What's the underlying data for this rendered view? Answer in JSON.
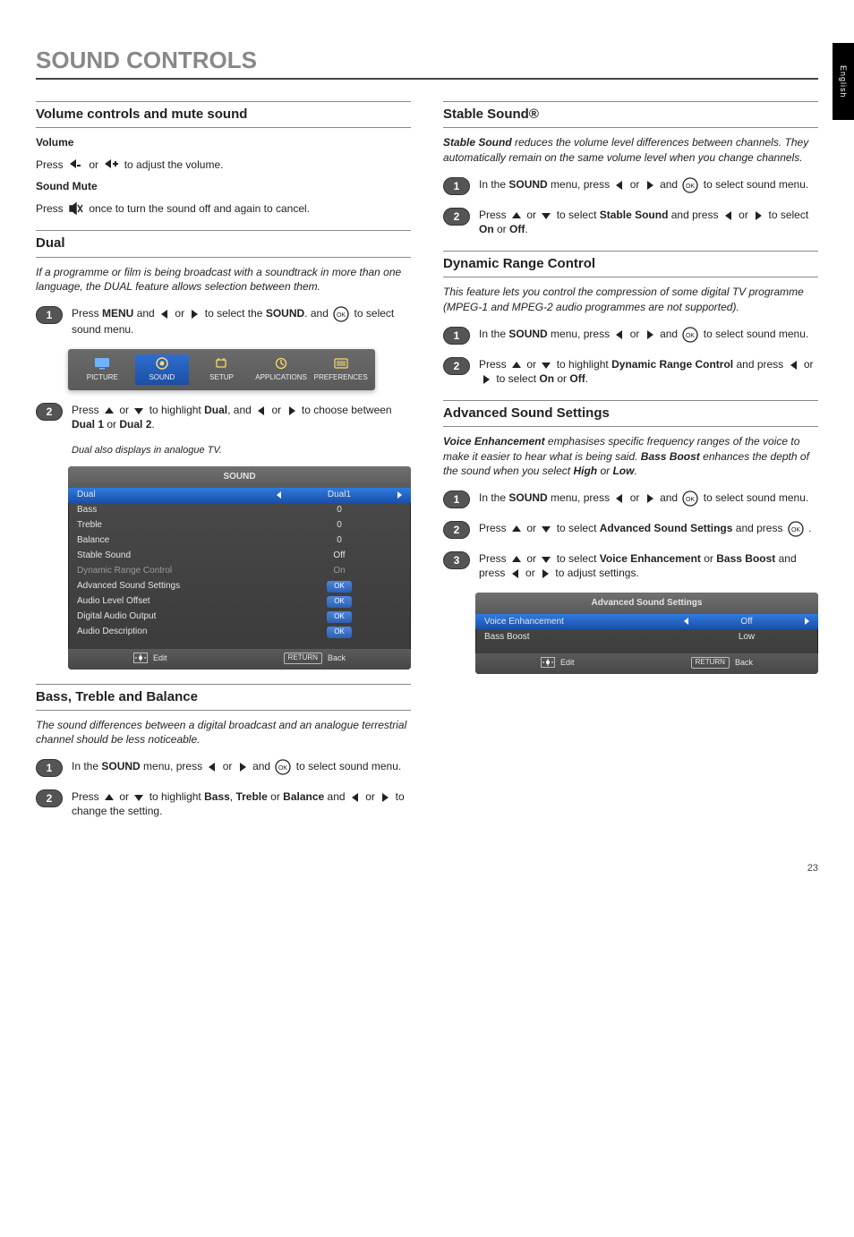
{
  "side_tab": "English",
  "page_title": "SOUND CONTROLS",
  "page_number": "23",
  "vol_mute": {
    "heading": "Volume controls and mute sound",
    "subhead_volume": "Volume",
    "volume_text_prefix": "Press ",
    "volume_text_mid": " or ",
    "volume_text_suffix": " to adjust the volume.",
    "subhead_mute": "Sound Mute",
    "mute_text_prefix": "Press ",
    "mute_text_suffix": " once to turn the sound off and again to cancel."
  },
  "dual": {
    "heading": "Dual",
    "intro": "If a programme or film is being broadcast with a soundtrack in more than one language, the DUAL feature allows selection between them.",
    "step1_prefix": "Press ",
    "step1_mid_a": " and ",
    "step1_mid_b": " or ",
    "step1_suffix": " to select the ",
    "step1_target": "SOUND",
    "step1_end": ".",
    "step2_part1": "Press ",
    "step2_part2": " or ",
    "step2_part3": " to highlight ",
    "step2_target": "Dual",
    "step2_part4": ", and ",
    "step2_part5": " or ",
    "step2_part6": " to choose between ",
    "step2_opt1": "Dual 1",
    "step2_opt2": "Dual 2",
    "step2_end": "."
  },
  "ribbon": {
    "items": [
      {
        "label": "PICTURE",
        "icon": "picture"
      },
      {
        "label": "SOUND",
        "icon": "sound",
        "active": true
      },
      {
        "label": "SETUP",
        "icon": "setup"
      },
      {
        "label": "APPLICATIONS",
        "icon": "apps"
      },
      {
        "label": "PREFERENCES",
        "icon": "prefs"
      }
    ]
  },
  "sound_menu": {
    "title": "SOUND",
    "rows": [
      {
        "label": "Dual",
        "value": "Dual1",
        "selected": true,
        "arrows": true
      },
      {
        "label": "Bass",
        "value": "0"
      },
      {
        "label": "Treble",
        "value": "0"
      },
      {
        "label": "Balance",
        "value": "0"
      },
      {
        "label": "Stable Sound",
        "value": "Off"
      },
      {
        "label": "Dynamic Range Control",
        "value": "On",
        "dim": true
      },
      {
        "label": "Advanced Sound Settings",
        "value": "OK",
        "pill": true
      },
      {
        "label": "Audio Level Offset",
        "value": "OK",
        "pill": true
      },
      {
        "label": "Digital Audio Output",
        "value": "OK",
        "pill": true
      },
      {
        "label": "Audio Description",
        "value": "OK",
        "pill": true
      }
    ],
    "footer_edit": "Edit",
    "footer_back": "Back",
    "footer_return": "RETURN"
  },
  "btb": {
    "heading": "Bass, Treble and Balance",
    "intro": "The sound differences between a digital broadcast and an analogue terrestrial channel should be less noticeable.",
    "step1_prefix": "In the ",
    "step1_menu": "SOUND",
    "step1_mid": " menu, press ",
    "step1_end": " to select sound menu.",
    "step2_p1": "Press ",
    "step2_p2": " or ",
    "step2_p3": " to highlight ",
    "step2_b": "Bass",
    "step2_t": "Treble",
    "step2_or1": ", ",
    "step2_or2": " or ",
    "step2_bal": "Balance",
    "step2_p4": " and ",
    "step2_p5": " or ",
    "step2_p6": " to change the setting."
  },
  "stable": {
    "heading": "Stable Sound®",
    "intro_prefix": "Stable Sound",
    "intro_suffix": " reduces the volume level differences between channels. They automatically remain on the same volume level when you change channels.",
    "step1_prefix": "In the ",
    "step1_menu": "SOUND",
    "step1_mid": " menu, press ",
    "step1_end": " to select sound menu.",
    "step2_p1": "Press ",
    "step2_p2": " or ",
    "step2_p3": " to select ",
    "step2_target": "Stable Sound",
    "step2_p4": " and press ",
    "step2_p5": " or ",
    "step2_p6": " to select ",
    "step2_on": "On",
    "step2_off": "Off",
    "step2_end": "."
  },
  "drc": {
    "heading": "Dynamic Range Control",
    "intro": "This feature lets you control the compression of some digital TV programme (MPEG-1 and MPEG-2 audio programmes are not supported).",
    "step1_prefix": "In the ",
    "step1_menu": "SOUND",
    "step1_mid": " menu, press ",
    "step1_end": " to select sound menu.",
    "step2_p1": "Press ",
    "step2_p2": " or ",
    "step2_p3": " to highlight ",
    "step2_target": "Dynamic Range Control",
    "step2_p4": " and press ",
    "step2_p5": " or ",
    "step2_p6": " to select ",
    "step2_on": "On",
    "step2_off": "Off",
    "step2_end": "."
  },
  "adv": {
    "heading": "Advanced Sound Settings",
    "intro_prefix": "Voice Enhancement",
    "intro_mid1": " emphasises specific frequency ranges of the voice to make it easier to hear what is being said. ",
    "intro_bb": "Bass Boost",
    "intro_mid2": " enhances the depth of the sound when you select ",
    "intro_high": "High",
    "intro_low": "Low",
    "intro_end": ".",
    "step1_prefix": "In the ",
    "step1_menu": "SOUND",
    "step1_mid": " menu, press ",
    "step1_end": " to select sound menu.",
    "step2_p1": "Press ",
    "step2_p2": " or ",
    "step2_p3": " to select ",
    "step2_target": "Advanced Sound Settings",
    "step2_p4": " and press ",
    "step2_end": ".",
    "step3_p1": "Press ",
    "step3_p2": " or ",
    "step3_p3": " to select ",
    "step3_ve": "Voice Enhancement",
    "step3_bb": "Bass Boost",
    "step3_p4": " and press ",
    "step3_p5": " or ",
    "step3_p6": " to adjust settings.",
    "menu_title": "Advanced Sound Settings",
    "rows": [
      {
        "label": "Voice Enhancement",
        "value": "Off",
        "selected": true,
        "arrows": true
      },
      {
        "label": "Bass Boost",
        "value": "Low"
      }
    ],
    "footer_edit": "Edit",
    "footer_back": "Back",
    "footer_return": "RETURN"
  },
  "dual_note": "Dual also displays in analogue TV."
}
